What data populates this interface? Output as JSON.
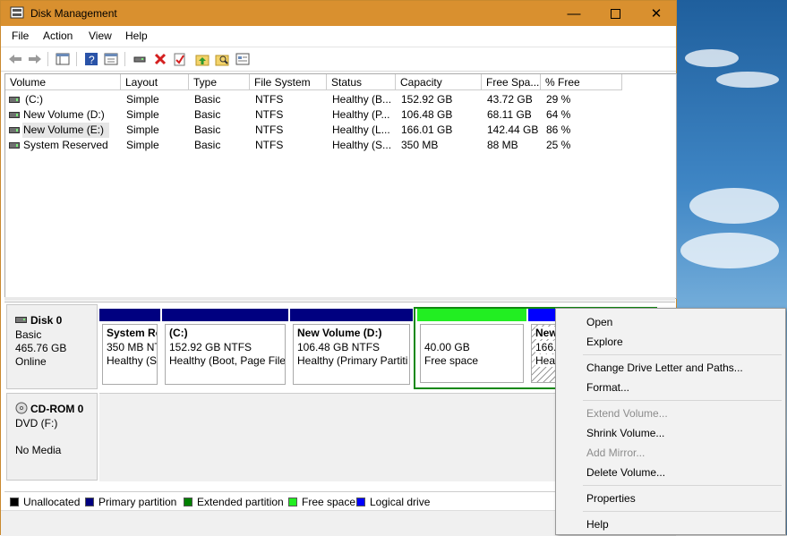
{
  "window": {
    "title": "Disk Management"
  },
  "menubar": {
    "items": [
      "File",
      "Action",
      "View",
      "Help"
    ]
  },
  "list": {
    "columns": [
      "Volume",
      "Layout",
      "Type",
      "File System",
      "Status",
      "Capacity",
      "Free Spa...",
      "% Free"
    ],
    "rows": [
      [
        "(C:)",
        "Simple",
        "Basic",
        "NTFS",
        "Healthy (B...",
        "152.92 GB",
        "43.72 GB",
        "29 %"
      ],
      [
        "New Volume (D:)",
        "Simple",
        "Basic",
        "NTFS",
        "Healthy (P...",
        "106.48 GB",
        "68.11 GB",
        "64 %"
      ],
      [
        "New Volume (E:)",
        "Simple",
        "Basic",
        "NTFS",
        "Healthy (L...",
        "166.01 GB",
        "142.44 GB",
        "86 %"
      ],
      [
        "System Reserved",
        "Simple",
        "Basic",
        "NTFS",
        "Healthy (S...",
        "350 MB",
        "88 MB",
        "25 %"
      ]
    ]
  },
  "disk0": {
    "name": "Disk 0",
    "type": "Basic",
    "size": "465.76 GB",
    "status": "Online",
    "partitions": [
      {
        "name": "System Re",
        "size": "350 MB NT",
        "status": "Healthy (S"
      },
      {
        "name": "(C:)",
        "size": "152.92 GB NTFS",
        "status": "Healthy (Boot, Page File,"
      },
      {
        "name": "New Volume  (D:)",
        "size": "106.48 GB NTFS",
        "status": "Healthy (Primary Partiti"
      },
      {
        "name": "",
        "size": "40.00 GB",
        "status": "Free space"
      },
      {
        "name": "New",
        "size": "166.0",
        "status": "Heal"
      }
    ]
  },
  "cdrom0": {
    "name": "CD-ROM 0",
    "type": "DVD (F:)",
    "status": "No Media"
  },
  "legend": {
    "items": [
      {
        "label": "Unallocated",
        "color": "#000000"
      },
      {
        "label": "Primary partition",
        "color": "#000080"
      },
      {
        "label": "Extended partition",
        "color": "#008000"
      },
      {
        "label": "Free space",
        "color": "#22ee22"
      },
      {
        "label": "Logical drive",
        "color": "#0000ff"
      }
    ]
  },
  "context_menu": {
    "open": "Open",
    "explore": "Explore",
    "change_letter": "Change Drive Letter and Paths...",
    "format": "Format...",
    "extend": "Extend Volume...",
    "shrink": "Shrink Volume...",
    "add_mirror": "Add Mirror...",
    "delete": "Delete Volume...",
    "properties": "Properties",
    "help": "Help"
  },
  "colors": {
    "titlebar": "#d9902f",
    "primary": "#000080",
    "free": "#22ee22",
    "logical": "#0000ff",
    "extended": "#008000"
  },
  "icons": [
    "back-icon",
    "forward-icon",
    "console-icon",
    "help-icon",
    "properties-icon",
    "connect-icon",
    "delete-icon",
    "check-icon",
    "folder-up-icon",
    "search-folder-icon",
    "settings-icon"
  ]
}
